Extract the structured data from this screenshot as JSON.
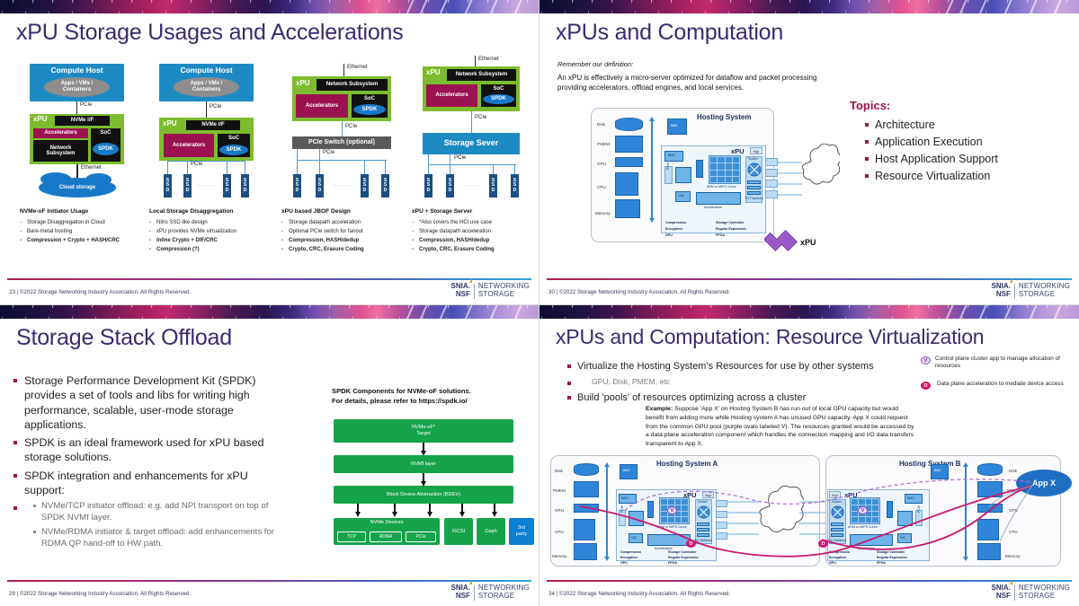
{
  "deck": {
    "footer_note_prefix": "©2022 Storage Networking Industry Association. All Rights Reserved.",
    "logo": {
      "line1": "SNIA.",
      "line2": "NSF",
      "line3": "NETWORKING",
      "line4": "STORAGE"
    },
    "accent_purple": "#3b2a6e",
    "accent_magenta": "#9b1250",
    "accent_green": "#7dbb2f",
    "accent_blue": "#1e8ac4"
  },
  "slide1": {
    "page": "23",
    "title": "xPU Storage Usages and Accelerations",
    "footer": "23 | ©2022 Storage Networking Industry Association. All Rights Reserved.",
    "labels": {
      "compute_host": "Compute Host",
      "apps_vms_containers": "Apps / VMs /\nContainers",
      "xpu": "xPU",
      "nvme_if": "NVMe I/F",
      "accelerators": "Accelerators",
      "network_subsystem": "Network\nSubsystem",
      "network_subsystem_wide": "Network Subsystem",
      "soc": "SoC",
      "spdk": "SPDK",
      "pcie": "PCIe",
      "ethernet": "Ethernet",
      "cloud_storage": "Cloud storage",
      "ssd": "SSD",
      "pcie_switch": "PCIe Switch (optional)",
      "storage_server": "Storage Sever",
      "ellipsis": "........"
    },
    "columns": [
      {
        "heading": "NVMe-oF Initiator Usage",
        "items": [
          {
            "text": "Storage Disaggregation in Cloud",
            "bold": false
          },
          {
            "text": "Bare-metal hosting",
            "bold": false
          },
          {
            "text": "Compression + Crypto + HASH/CRC",
            "bold": true
          }
        ]
      },
      {
        "heading": "Local Storage Disaggregation",
        "items": [
          {
            "text": "Nitro SSD like design",
            "bold": false
          },
          {
            "text": "xPU provides NVMe virtualization",
            "bold": false
          },
          {
            "text": "Inline Crypto + DIF/CRC",
            "bold": true
          },
          {
            "text": "Compression (?)",
            "bold": true
          }
        ]
      },
      {
        "heading": "xPU based JBOF Design",
        "items": [
          {
            "text": "Storage datapath acceleration",
            "bold": false
          },
          {
            "text": "Optional PCIe switch for fanout",
            "bold": false
          },
          {
            "text": "Compression, HASH/dedup",
            "bold": true
          },
          {
            "text": "Crypto, CRC, Erasure Coding",
            "bold": true
          }
        ]
      },
      {
        "heading": "xPU + Storage Server",
        "items": [
          {
            "text": "*Also covers the HCI use case",
            "bold": false
          },
          {
            "text": "Storage datapath acceleration",
            "bold": false
          },
          {
            "text": "Compression, HASH/dedup",
            "bold": true
          },
          {
            "text": "Crypto, CRC, Erasure Coding",
            "bold": true
          }
        ]
      }
    ]
  },
  "slide2": {
    "page": "30",
    "title": "xPUs and Computation",
    "footer": "30 | ©2022 Storage Networking Industry Association. All Rights Reserved.",
    "definition_lead": "Remember our definition:",
    "definition_body": "An xPU is effectively a micro-server optimized for dataflow and packet processing providing accelerators, offload engines, and local services.",
    "topics_heading": "Topics:",
    "topics": [
      "Architecture",
      "Application Execution",
      "Host Application Support",
      "Resource Virtualization"
    ],
    "diagram": {
      "hosting_system": "Hosting System",
      "xpu_label": "xPU",
      "xpu_callout": "xPU",
      "mgt": "Mgt",
      "rows": [
        "Disk",
        "PMEM",
        "GPU",
        "CPU",
        "Memory"
      ],
      "bmc": "BMC",
      "nic": "NIC",
      "pcie": "PCIe",
      "cores": "ARM or MIPS Cores",
      "accelerators": "Accelerators",
      "switch": "Switch",
      "p4_pipelines": "P4 Pipelines",
      "services": [
        "Compression",
        "Encryption",
        "GPU",
        "Storage Controller",
        "Regular Expression",
        "FPGA"
      ]
    }
  },
  "slide3": {
    "page": "28",
    "title": "Storage Stack Offload",
    "footer": "28 | ©2022 Storage Networking Industry Association. All Rights Reserved.",
    "bullets": [
      "Storage Performance Development Kit (SPDK) provides a set of tools and libs for writing high performance, scalable, user-mode storage applications.",
      "SPDK is an ideal framework used for xPU based storage solutions.",
      "SPDK integration and enhancements for xPU support:"
    ],
    "sub_bullets": [
      "NVMe/TCP initiator offload: e.g. add NPI transport on top of SPDK NVMf layer.",
      "NVMe/RDMA initiator & target offload: add enhancements for RDMA QP hand-off to HW path."
    ],
    "diagram": {
      "caption_line1": "SPDK Components for NVMe-oF solutions.",
      "caption_line2": "For details, please refer to https://spdk.io/",
      "layers": [
        "NVMe-oF*\nTarget",
        "NVMf layer",
        "Block Device Abstraction (BDEV)"
      ],
      "devices_group_label": "NVMe Devices",
      "devices": [
        "TCP",
        "RDMA",
        "PCIe"
      ],
      "others": [
        "iSCSI",
        "Ceph"
      ],
      "third_party": "3rd\nparty"
    }
  },
  "slide4": {
    "page": "34",
    "title": "xPUs and Computation: Resource Virtualization",
    "footer": "34 | ©2022 Storage Networking Industry Association. All Rights Reserved.",
    "bullets": [
      "Virtualize the Hosting System's Resources for use by other systems",
      "Build 'pools' of resources optimizing across a cluster"
    ],
    "sub_bullet": "GPU, Disk, PMEM, etc",
    "legend": [
      {
        "badge": "V",
        "text": "Control plane cluster app to manage allocation of resources"
      },
      {
        "badge": "D",
        "text": "Data plane acceleration to mediate device access"
      }
    ],
    "example_label": "Example:",
    "example_text": " Suppose 'App X' on Hosting System B has run out of local GPU capacity but would benefit from adding more while Hosting system A has unused GPU capacity. App X could request from the common GPU pool (purple ovals labeled V). The resources granted would be accessed by a data plane acceleration component which handles the connection mapping and I/O data transfers transparent to App X.",
    "diagram": {
      "system_a": "Hosting System A",
      "system_b": "Hosting System B",
      "app_x": "App X",
      "xpu_label": "xPU",
      "mgt": "Mgt",
      "rows": [
        "Disk",
        "PMEM",
        "GPU",
        "CPU",
        "Memory"
      ],
      "bmc": "BMC",
      "nic": "NIC",
      "pcie": "PCIe",
      "cores": "ARM or MIPS Cores",
      "accelerators": "Accelerators",
      "switch": "Switch",
      "p4_pipelines": "P4 Pipelines",
      "services": [
        "Compression",
        "Encryption",
        "GPU",
        "Storage Controller",
        "Regular Expression",
        "FPGA"
      ],
      "badge_v": "V",
      "badge_d": "D"
    }
  }
}
